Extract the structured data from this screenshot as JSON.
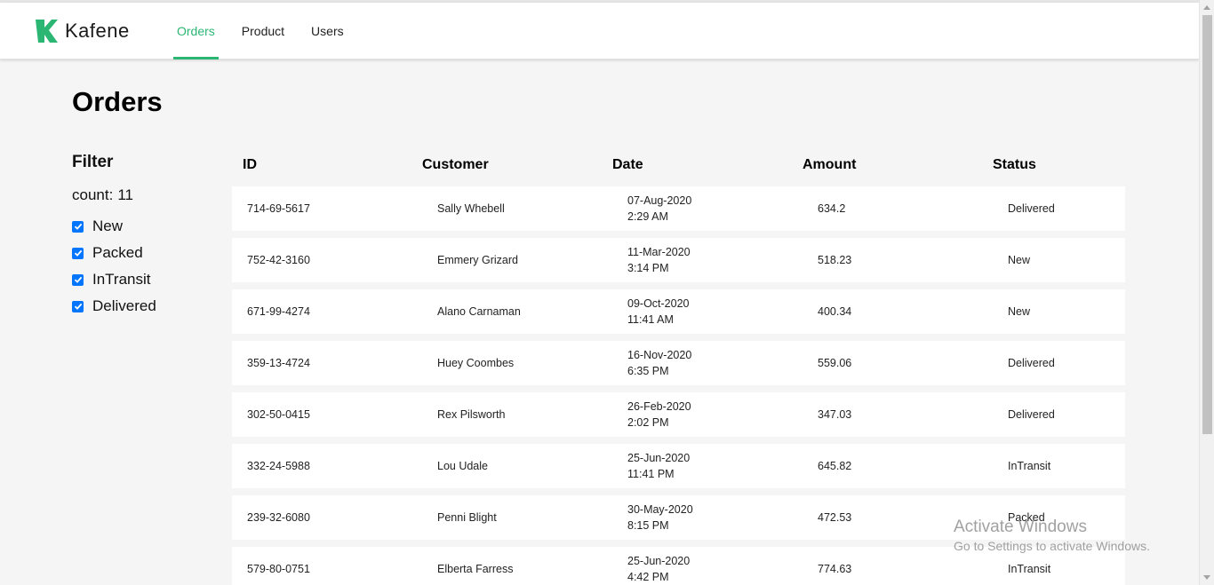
{
  "app": {
    "name": "Kafene",
    "brand_color": "#2bb673"
  },
  "nav": {
    "items": [
      {
        "label": "Orders",
        "active": true
      },
      {
        "label": "Product",
        "active": false
      },
      {
        "label": "Users",
        "active": false
      }
    ]
  },
  "page": {
    "title": "Orders"
  },
  "filter": {
    "title": "Filter",
    "count_label": "count:",
    "count_value": "11",
    "options": [
      {
        "label": "New",
        "checked": true
      },
      {
        "label": "Packed",
        "checked": true
      },
      {
        "label": "InTransit",
        "checked": true
      },
      {
        "label": "Delivered",
        "checked": true
      }
    ]
  },
  "table": {
    "columns": [
      "ID",
      "Customer",
      "Date",
      "Amount",
      "Status"
    ],
    "rows": [
      {
        "id": "714-69-5617",
        "customer": "Sally Whebell",
        "date": "07-Aug-2020",
        "time": "2:29 AM",
        "amount": "634.2",
        "status": "Delivered"
      },
      {
        "id": "752-42-3160",
        "customer": "Emmery Grizard",
        "date": "11-Mar-2020",
        "time": "3:14 PM",
        "amount": "518.23",
        "status": "New"
      },
      {
        "id": "671-99-4274",
        "customer": "Alano Carnaman",
        "date": "09-Oct-2020",
        "time": "11:41 AM",
        "amount": "400.34",
        "status": "New"
      },
      {
        "id": "359-13-4724",
        "customer": "Huey Coombes",
        "date": "16-Nov-2020",
        "time": "6:35 PM",
        "amount": "559.06",
        "status": "Delivered"
      },
      {
        "id": "302-50-0415",
        "customer": "Rex Pilsworth",
        "date": "26-Feb-2020",
        "time": "2:02 PM",
        "amount": "347.03",
        "status": "Delivered"
      },
      {
        "id": "332-24-5988",
        "customer": "Lou Udale",
        "date": "25-Jun-2020",
        "time": "11:41 PM",
        "amount": "645.82",
        "status": "InTransit"
      },
      {
        "id": "239-32-6080",
        "customer": "Penni Blight",
        "date": "30-May-2020",
        "time": "8:15 PM",
        "amount": "472.53",
        "status": "Packed"
      },
      {
        "id": "579-80-0751",
        "customer": "Elberta Farress",
        "date": "25-Jun-2020",
        "time": "4:42 PM",
        "amount": "774.63",
        "status": "InTransit"
      }
    ]
  },
  "watermark": {
    "title": "Activate Windows",
    "subtitle": "Go to Settings to activate Windows."
  }
}
